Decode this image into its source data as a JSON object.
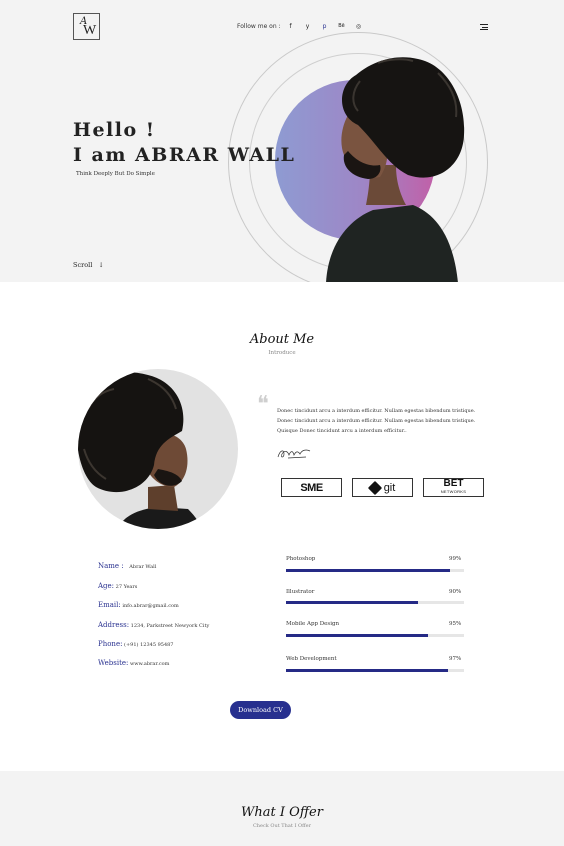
{
  "header": {
    "logo": {
      "top": "A",
      "bottom": "W"
    },
    "follow_label": "Follow me on :",
    "social": [
      {
        "icon": "facebook-icon",
        "glyph": "f"
      },
      {
        "icon": "twitter-icon",
        "glyph": "y"
      },
      {
        "icon": "pinterest-icon",
        "glyph": "p"
      },
      {
        "icon": "behance-icon",
        "glyph": "Bē"
      },
      {
        "icon": "dribbble-icon",
        "glyph": "◎"
      }
    ]
  },
  "hero": {
    "line1": "Hello !",
    "line2": "I am ABRAR WALL",
    "tagline": "Think Deeply But Do Simple",
    "scroll": "Scroll",
    "scroll_arrow": "↓"
  },
  "about": {
    "title": "About Me",
    "subtitle": "Introduce",
    "quote_mark": "❝",
    "quote": "Donec tincidunt arcu a interdum efficitur. Nullam egestas bibendum tristique. Donec tincidunt arcu a interdum efficitur. Nullam egestas bibendum tristique. Quisque Donec tincidunt arcu a interdum efficitur..",
    "brands": {
      "sme": "SME",
      "git": "git",
      "bet": "BET",
      "bet_sub": "NETWORKS"
    },
    "info": [
      {
        "label": "Name :",
        "value": "Abrar Wall"
      },
      {
        "label": "Age:",
        "value": "27 Years"
      },
      {
        "label": "Email:",
        "value": "info.abrar@gmail.com"
      },
      {
        "label": "Address:",
        "value": "1234, Parkstreet Newyork City"
      },
      {
        "label": "Phone:",
        "value": "(+91) 12345 95487"
      },
      {
        "label": "Website:",
        "value": "www.abrar.com"
      }
    ],
    "skills": [
      {
        "name": "Photoshop",
        "percent_label": "99%",
        "level": 0.92
      },
      {
        "name": "Illustrator",
        "percent_label": "90%",
        "level": 0.74
      },
      {
        "name": "Mobile App Design",
        "percent_label": "95%",
        "level": 0.8
      },
      {
        "name": "Web Development",
        "percent_label": "97%",
        "level": 0.91
      }
    ],
    "download_label": "Download CV"
  },
  "offer": {
    "title": "What I Offer",
    "subtitle": "Check Out That I Offer"
  },
  "colors": {
    "accent": "#27308f",
    "hero_bg": "#f3f3f3"
  }
}
